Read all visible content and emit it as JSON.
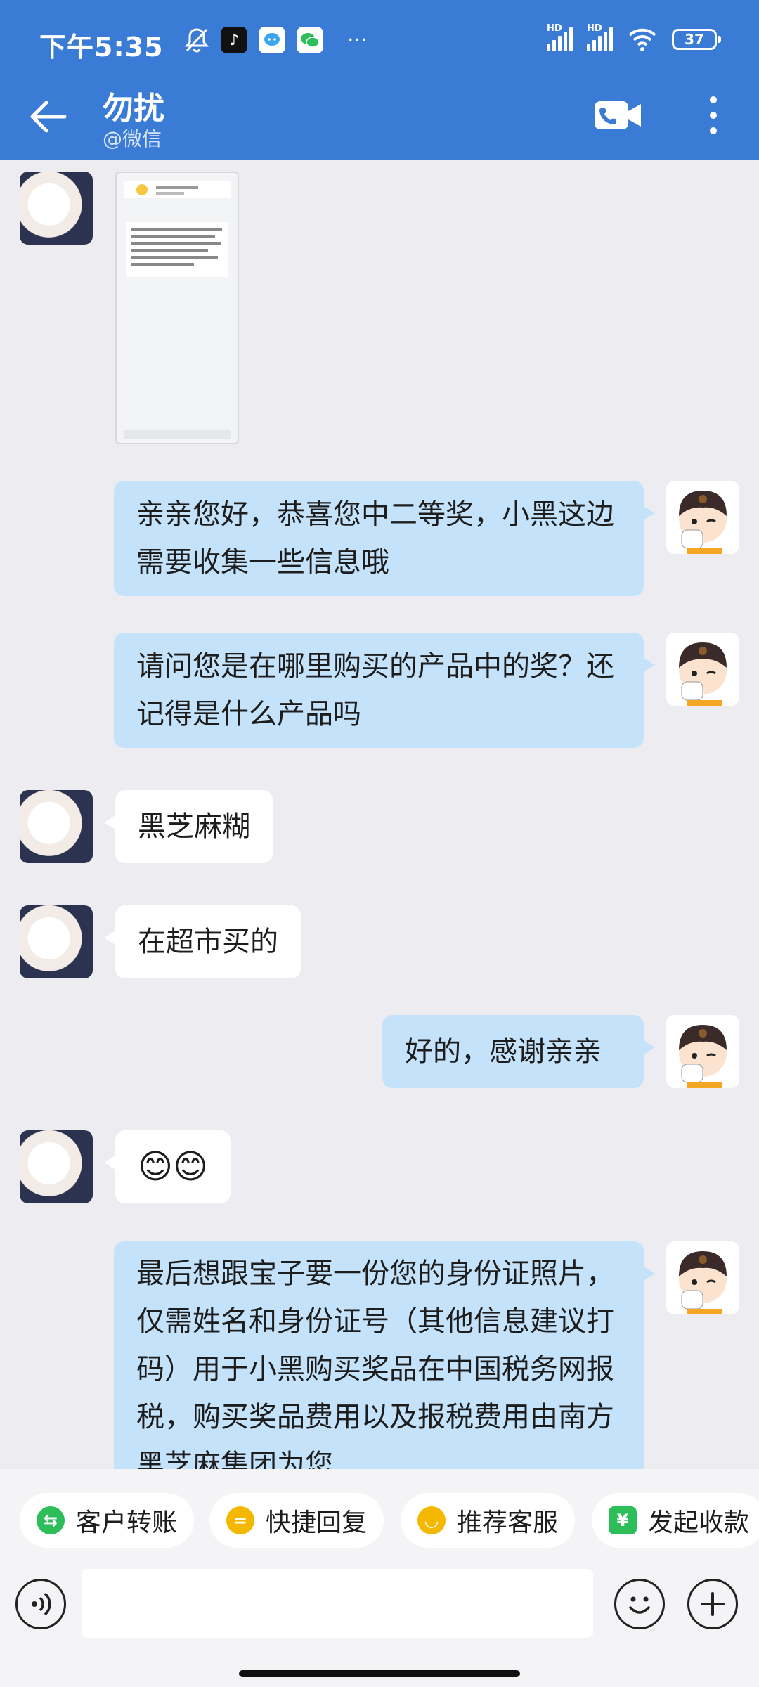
{
  "status_bar": {
    "time": "下午5:35",
    "network_label": "HD",
    "battery": "37"
  },
  "header": {
    "title": "勿扰",
    "subtitle": "@微信"
  },
  "messages": [
    {
      "side": "left",
      "type": "image"
    },
    {
      "side": "right",
      "text": "亲亲您好，恭喜您中二等奖，小黑这边需要收集一些信息哦"
    },
    {
      "side": "right",
      "text": "请问您是在哪里购买的产品中的奖？还记得是什么产品吗"
    },
    {
      "side": "left",
      "text": "黑芝麻糊"
    },
    {
      "side": "left",
      "text": "在超市买的"
    },
    {
      "side": "right",
      "text": "好的，感谢亲亲"
    },
    {
      "side": "left",
      "text": "😊😊"
    },
    {
      "side": "right",
      "text": "最后想跟宝子要一份您的身份证照片，仅需姓名和身份证号（其他信息建议打码）用于小黑购买奖品在中国税务网报税，购买奖品费用以及报税费用由南方黑芝麻集团为您"
    }
  ],
  "quick_actions": [
    {
      "label": "客户转账",
      "icon": "transfer-icon",
      "color": "#2DBE5A"
    },
    {
      "label": "快捷回复",
      "icon": "quick-reply-icon",
      "color": "#F5B800"
    },
    {
      "label": "推荐客服",
      "icon": "recommend-icon",
      "color": "#F5B800"
    },
    {
      "label": "发起收款",
      "icon": "payment-shield-icon",
      "color": "#2DBE5A"
    }
  ],
  "input": {
    "placeholder": ""
  },
  "colors": {
    "header": "#3A7BD5",
    "bubble_right": "#C5E2FB",
    "bubble_left": "#FFFFFF",
    "background": "#EDEDF1"
  }
}
